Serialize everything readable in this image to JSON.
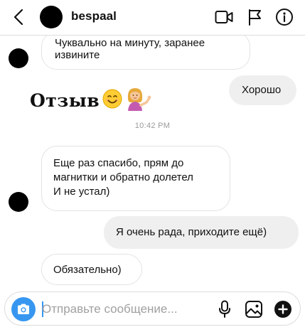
{
  "header": {
    "username": "bespaal",
    "icons": {
      "back": "chevron-left-icon",
      "video": "video-call-icon",
      "flag": "flag-icon",
      "info": "info-icon"
    }
  },
  "messages": [
    {
      "side": "incoming",
      "lines": [
        "Чуквально на минуту, заранее",
        "извините"
      ]
    },
    {
      "side": "outgoing",
      "text": "Хорошо"
    },
    {
      "side": "incoming",
      "sticker_text": "Отзыв",
      "emojis": [
        "smiling-face-emoji",
        "person-tipping-hand-emoji"
      ]
    },
    {
      "side": "incoming",
      "lines": [
        "Еще раз спасибо, прям до",
        "магнитки и обратно долетел",
        "И не устал)"
      ]
    },
    {
      "side": "outgoing",
      "text": "Я очень рада, приходите ещё)"
    },
    {
      "side": "incoming",
      "text": "Обязательно)"
    }
  ],
  "timestamp": "10:42 PM",
  "composer": {
    "placeholder": "Отправьте сообщение...",
    "value": "",
    "icons": {
      "camera": "camera-icon",
      "mic": "microphone-icon",
      "gallery": "gallery-icon",
      "plus": "plus-icon"
    }
  },
  "colors": {
    "accent": "#3797f0",
    "outgoing_bubble": "#efefef",
    "incoming_border": "#e3e3e3",
    "timestamp": "#9a9a9a"
  }
}
